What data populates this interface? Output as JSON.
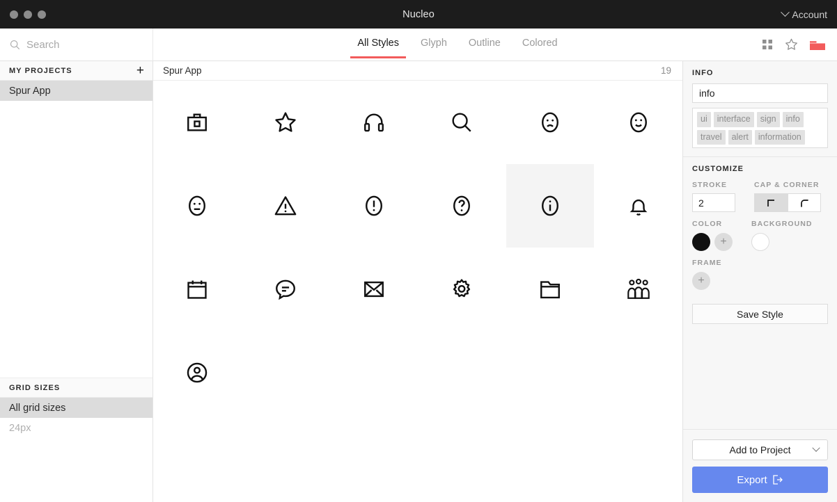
{
  "window": {
    "title": "Nucleo",
    "account_label": "Account",
    "traffic_lights": [
      "close",
      "minimize",
      "zoom"
    ]
  },
  "toolbar": {
    "search_placeholder": "Search",
    "tabs": [
      {
        "label": "All Styles",
        "active": true
      },
      {
        "label": "Glyph",
        "active": false
      },
      {
        "label": "Outline",
        "active": false
      },
      {
        "label": "Colored",
        "active": false
      }
    ],
    "icons": [
      "grid-view-icon",
      "star-icon",
      "folder-icon"
    ],
    "accent_color": "#f25b5b"
  },
  "sidebar": {
    "projects_header": "MY PROJECTS",
    "add_project_label": "+",
    "projects": [
      {
        "label": "Spur App",
        "selected": true
      }
    ],
    "grid_sizes_header": "GRID SIZES",
    "grid_sizes": [
      {
        "label": "All grid sizes",
        "selected": true,
        "muted": false
      },
      {
        "label": "24px",
        "selected": false,
        "muted": true
      }
    ]
  },
  "content": {
    "collection_name": "Spur App",
    "count": "19",
    "icons": [
      {
        "name": "briefcase-icon",
        "selected": false
      },
      {
        "name": "star-icon",
        "selected": false
      },
      {
        "name": "headphones-icon",
        "selected": false
      },
      {
        "name": "search-icon",
        "selected": false
      },
      {
        "name": "sad-face-icon",
        "selected": false
      },
      {
        "name": "smile-face-icon",
        "selected": false
      },
      {
        "name": "neutral-face-icon",
        "selected": false
      },
      {
        "name": "warning-triangle-icon",
        "selected": false
      },
      {
        "name": "exclamation-circle-icon",
        "selected": false
      },
      {
        "name": "question-circle-icon",
        "selected": false
      },
      {
        "name": "info-circle-icon",
        "selected": true
      },
      {
        "name": "bell-icon",
        "selected": false
      },
      {
        "name": "calendar-icon",
        "selected": false
      },
      {
        "name": "chat-bubble-icon",
        "selected": false
      },
      {
        "name": "envelope-icon",
        "selected": false
      },
      {
        "name": "gear-icon",
        "selected": false
      },
      {
        "name": "folder-icon",
        "selected": false
      },
      {
        "name": "group-users-icon",
        "selected": false
      },
      {
        "name": "user-circle-icon",
        "selected": false
      }
    ]
  },
  "inspector": {
    "info_header": "INFO",
    "icon_name": "info",
    "tags": [
      "ui",
      "interface",
      "sign",
      "info",
      "travel",
      "alert",
      "information"
    ],
    "customize_header": "CUSTOMIZE",
    "stroke_label": "STROKE",
    "stroke_value": "2",
    "cap_corner_label": "CAP & CORNER",
    "cap_options": [
      {
        "name": "square-corner",
        "selected": true
      },
      {
        "name": "round-corner",
        "selected": false
      }
    ],
    "color_label": "COLOR",
    "color_value": "#111111",
    "color_add_label": "+",
    "background_label": "BACKGROUND",
    "background_value": "#ffffff",
    "frame_label": "FRAME",
    "frame_add_label": "+",
    "save_style_label": "Save Style",
    "add_to_project_label": "Add to Project",
    "export_label": "Export",
    "export_color": "#6688ee"
  }
}
